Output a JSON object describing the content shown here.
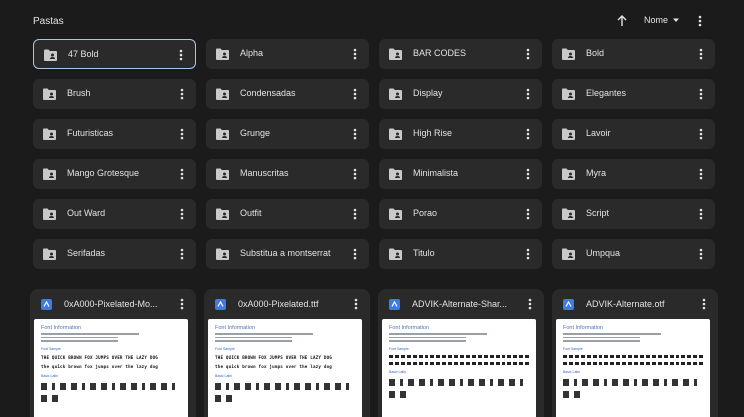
{
  "header": {
    "title": "Pastas",
    "sort_label": "Nome"
  },
  "folders": [
    {
      "name": "47 Bold"
    },
    {
      "name": "Alpha"
    },
    {
      "name": "BAR CODES"
    },
    {
      "name": "Bold"
    },
    {
      "name": "Brush"
    },
    {
      "name": "Condensadas"
    },
    {
      "name": "Display"
    },
    {
      "name": "Elegantes"
    },
    {
      "name": "Futuristicas"
    },
    {
      "name": "Grunge"
    },
    {
      "name": "High Rise"
    },
    {
      "name": "Lavoir"
    },
    {
      "name": "Mango Grotesque"
    },
    {
      "name": "Manuscritas"
    },
    {
      "name": "Minimalista"
    },
    {
      "name": "Myra"
    },
    {
      "name": "Out Ward"
    },
    {
      "name": "Outfit"
    },
    {
      "name": "Porao"
    },
    {
      "name": "Script"
    },
    {
      "name": "Serifadas"
    },
    {
      "name": "Substitua a montserrat"
    },
    {
      "name": "Titulo"
    },
    {
      "name": "Umpqua"
    }
  ],
  "files": [
    {
      "name": "0xA000-Pixelated-Mo...",
      "preview_title": "Font Information",
      "sample1": "THE QUICK BROWN FOX JUMPS OVER THE LAZY DOG",
      "sample2": "the quick brown fox jumps over the lazy dog",
      "label_sample": "Font Sample",
      "label_basic": "Basic Latin"
    },
    {
      "name": "0xA000-Pixelated.ttf",
      "preview_title": "Font Information",
      "sample1": "THE QUICK BROWN FOX JUMPS OVER THE LAZY DOG",
      "sample2": "the quick brown fox jumps over the lazy dog",
      "label_sample": "Font Sample",
      "label_basic": "Basic Latin"
    },
    {
      "name": "ADVIK-Alternate-Shar...",
      "preview_title": "Font Information",
      "label_sample": "Font Sample",
      "label_basic": "Basic Latin"
    },
    {
      "name": "ADVIK-Alternate.otf",
      "preview_title": "Font Information",
      "label_sample": "Font Sample",
      "label_basic": "Basic Latin"
    }
  ],
  "colors": {
    "background": "#1b1b1b",
    "card": "#2a2a2a",
    "selected_border": "#a9c4ea",
    "file_icon": "#3f7ce0"
  }
}
